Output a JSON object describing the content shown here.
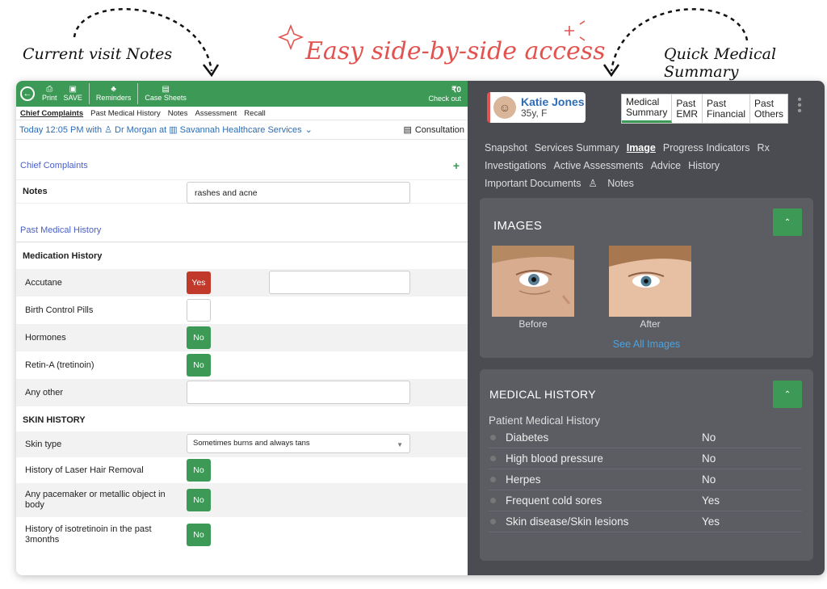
{
  "annotations": {
    "left": "Current visit Notes",
    "center": "Easy side-by-side access",
    "right": "Quick Medical Summary"
  },
  "colors": {
    "accent_green": "#3d9a56",
    "accent_red": "#e2534f",
    "toggle_yes": "#c0392b",
    "link_blue": "#2d6db5",
    "dark_panel": "#4a4c52"
  },
  "toolbar": {
    "print": "Print",
    "save": "SAVE",
    "reminders": "Reminders",
    "case_sheets": "Case Sheets",
    "amount": "₹0",
    "checkout": "Check out"
  },
  "tabs": [
    "Chief Complaints",
    "Past Medical History",
    "Notes",
    "Assessment",
    "Recall"
  ],
  "visit": {
    "when": "Today 12:05 PM with",
    "doctor": "Dr Morgan at",
    "clinic": "Savannah Healthcare Services",
    "consultation": "Consultation"
  },
  "chief": {
    "title": "Chief Complaints",
    "notes_label": "Notes",
    "notes_value": "rashes and acne"
  },
  "pmh": {
    "title": "Past Medical History",
    "medication_title": "Medication History",
    "accutane": "Accutane",
    "accutane_val": "Yes",
    "bcp": "Birth Control Pills",
    "hormones": "Hormones",
    "hormones_val": "No",
    "retina": "Retin-A (tretinoin)",
    "retina_val": "No",
    "any_other": "Any other",
    "skin_title": "SKIN HISTORY",
    "skin_type": "Skin type",
    "skin_type_val": "Sometimes burns and always tans",
    "laser": "History of Laser Hair Removal",
    "laser_val": "No",
    "pacemaker": "Any pacemaker or metallic object in body",
    "pacemaker_val": "No",
    "isotretinoin": "History of isotretinoin in the past 3months",
    "isotretinoin_val": "No"
  },
  "patient": {
    "name": "Katie Jones",
    "age": "35y, F"
  },
  "summary_tabs": [
    {
      "l1": "Medical",
      "l2": "Summary"
    },
    {
      "l1": "Past",
      "l2": "EMR"
    },
    {
      "l1": "Past",
      "l2": "Financial"
    },
    {
      "l1": "Past",
      "l2": "Others"
    }
  ],
  "nav": [
    "Snapshot",
    "Services Summary",
    "Image",
    "Progress Indicators",
    "Rx",
    "Investigations",
    "Active Assessments",
    "Advice",
    "History",
    "Important Documents",
    "Notes"
  ],
  "images": {
    "title": "IMAGES",
    "before": "Before",
    "after": "After",
    "see_all": "See All Images"
  },
  "medical_history": {
    "title": "MEDICAL HISTORY",
    "subtitle": "Patient Medical History",
    "rows": [
      {
        "condition": "Diabetes",
        "value": "No"
      },
      {
        "condition": "High blood pressure",
        "value": "No"
      },
      {
        "condition": "Herpes",
        "value": "No"
      },
      {
        "condition": "Frequent cold sores",
        "value": "Yes"
      },
      {
        "condition": "Skin disease/Skin lesions",
        "value": "Yes"
      }
    ]
  }
}
